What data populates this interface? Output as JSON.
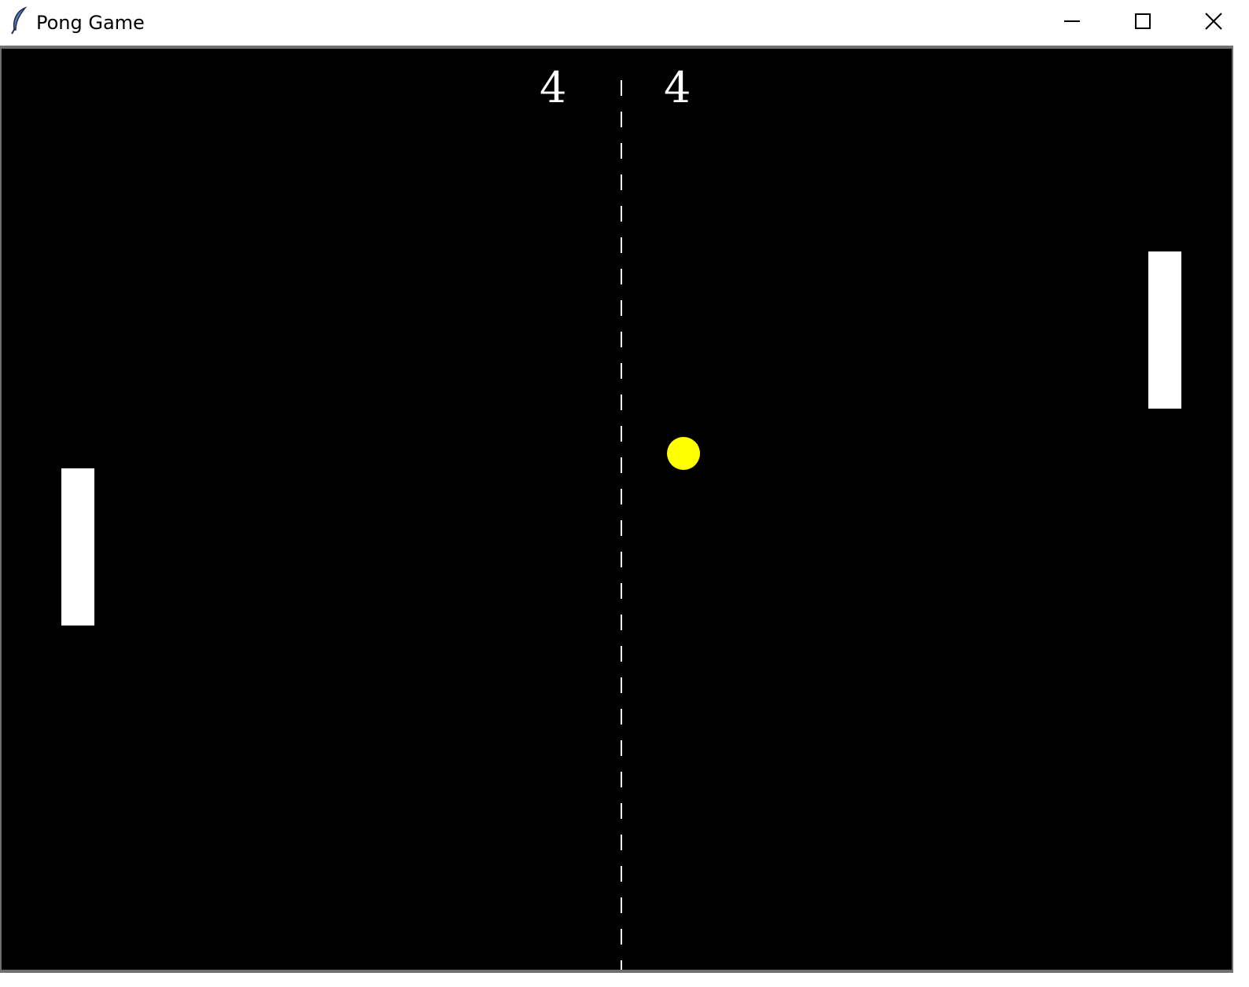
{
  "window": {
    "title": "Pong Game",
    "controls": {
      "minimize_icon": "minimize-icon",
      "maximize_icon": "maximize-icon",
      "close_icon": "close-icon"
    }
  },
  "game": {
    "score_left": "4",
    "score_right": "4",
    "colors": {
      "background": "#000000",
      "paddle": "#ffffff",
      "ball": "#ffff00",
      "net": "#ffffff",
      "score": "#ffffff"
    }
  }
}
